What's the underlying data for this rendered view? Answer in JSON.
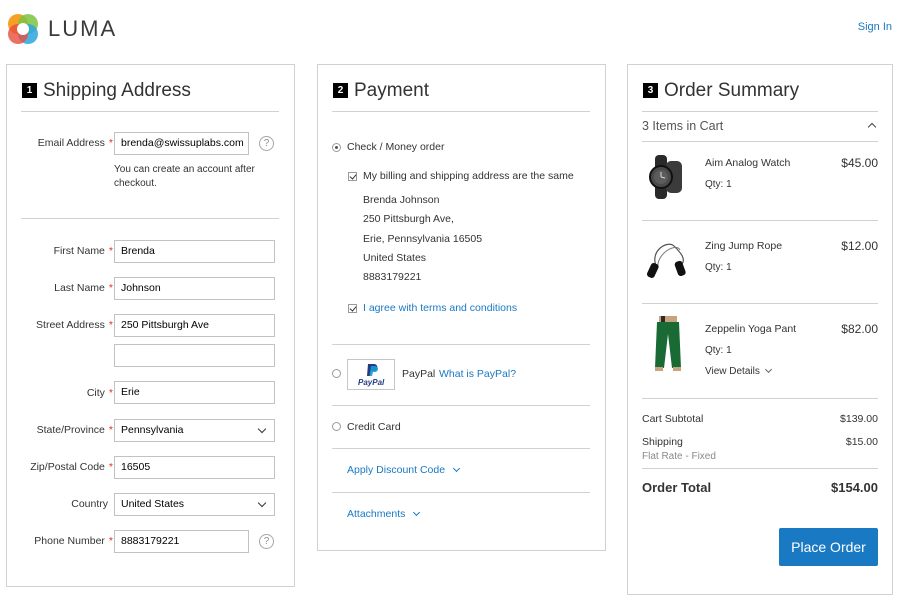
{
  "header": {
    "brand": "LUMA",
    "signin": "Sign In"
  },
  "shipping": {
    "step": "1",
    "title": "Shipping Address",
    "email_label": "Email Address",
    "email_value": "brenda@swissuplabs.com",
    "account_note_line1": "You can create an account after",
    "account_note_line2": "checkout.",
    "first_name_label": "First Name",
    "first_name_value": "Brenda",
    "last_name_label": "Last Name",
    "last_name_value": "Johnson",
    "street_label": "Street Address",
    "street_value": "250 Pittsburgh Ave",
    "street2_value": "",
    "city_label": "City",
    "city_value": "Erie",
    "state_label": "State/Province",
    "state_value": "Pennsylvania",
    "zip_label": "Zip/Postal Code",
    "zip_value": "16505",
    "country_label": "Country",
    "country_value": "United States",
    "phone_label": "Phone Number",
    "phone_value": "8883179221",
    "required_mark": "*",
    "help_glyph": "?"
  },
  "payment": {
    "step": "2",
    "title": "Payment",
    "check_money_label": "Check / Money order",
    "same_address_label": "My billing and shipping address are the same",
    "address_lines": [
      "Brenda Johnson",
      "250 Pittsburgh Ave,",
      "Erie, Pennsylvania 16505",
      "United States",
      "8883179221"
    ],
    "agree_label": "I agree with terms and conditions",
    "paypal_logo": "PayPal",
    "paypal_label": "PayPal",
    "paypal_link": "What is PayPal?",
    "credit_card_label": "Credit Card",
    "discount_label": "Apply Discount Code",
    "attachments_label": "Attachments"
  },
  "summary": {
    "step": "3",
    "title": "Order Summary",
    "items_in_cart": "3 Items in Cart",
    "items": [
      {
        "name": "Aim Analog Watch",
        "qty": "Qty: 1",
        "price": "$45.00"
      },
      {
        "name": "Zing Jump Rope",
        "qty": "Qty: 1",
        "price": "$12.00"
      },
      {
        "name": "Zeppelin Yoga Pant",
        "qty": "Qty: 1",
        "price": "$82.00",
        "details": "View Details"
      }
    ],
    "subtotal_label": "Cart Subtotal",
    "subtotal_value": "$139.00",
    "shipping_label": "Shipping",
    "shipping_method": "Flat Rate - Fixed",
    "shipping_value": "$15.00",
    "total_label": "Order Total",
    "total_value": "$154.00",
    "place_order": "Place Order"
  },
  "colors": {
    "accent": "#1979c3",
    "required": "#e02b27",
    "border": "#d1d1d1"
  }
}
